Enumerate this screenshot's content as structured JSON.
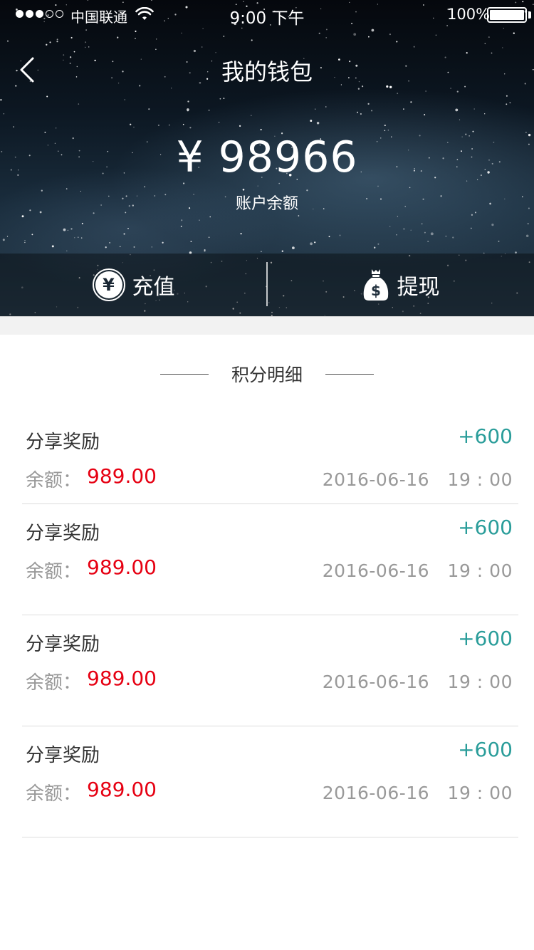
{
  "status_bar": {
    "carrier": "中国联通",
    "time": "9:00 下午",
    "battery": "100%",
    "signal_bars_on": 3
  },
  "header": {
    "title": "我的钱包",
    "balance_amount": "¥ 98966",
    "balance_label": "账户余额"
  },
  "actions": {
    "recharge_label": "充值",
    "recharge_icon_glyph": "¥",
    "withdraw_label": "提现"
  },
  "section": {
    "title": "积分明细"
  },
  "records": [
    {
      "title": "分享奖励",
      "change": "+600",
      "balance_label": "余额：",
      "balance_value": "989.00",
      "time": "2016-06-16　19 : 00"
    },
    {
      "title": "分享奖励",
      "change": "+600",
      "balance_label": "余额：",
      "balance_value": "989.00",
      "time": "2016-06-16　19 : 00"
    },
    {
      "title": "分享奖励",
      "change": "+600",
      "balance_label": "余额：",
      "balance_value": "989.00",
      "time": "2016-06-16　19 : 00"
    },
    {
      "title": "分享奖励",
      "change": "+600",
      "balance_label": "余额：",
      "balance_value": "989.00",
      "time": "2016-06-16　19 : 00"
    }
  ],
  "colors": {
    "accent_change": "#2a9d9a",
    "balance_value": "#e60012"
  }
}
